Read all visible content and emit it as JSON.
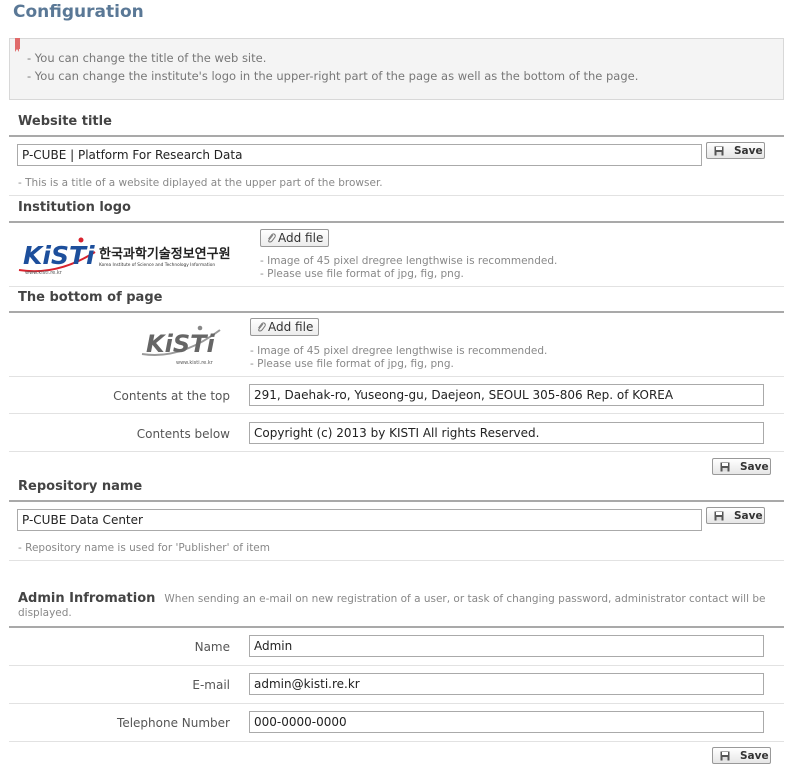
{
  "page_title": "Configuration",
  "notice": [
    "- You can change the title of the web site.",
    "- You can change the institute's logo in the upper-right part of the page as well as the bottom of the page."
  ],
  "save_label": "Save",
  "add_file_label": "Add file",
  "website_title": {
    "heading": "Website title",
    "value": "P-CUBE | Platform For Research Data",
    "hint": "- This is a title of a website diplayed at the upper part of the browser."
  },
  "institution_logo": {
    "heading": "Institution logo",
    "logo_text": "KiSTi",
    "logo_korean": "한국과학기술정보연구원",
    "logo_english": "Korea Institute of Science and Technology Information",
    "logo_url": "www.kisti.re.kr",
    "hint1": "- Image of 45 pixel dregree lengthwise is recommended.",
    "hint2": "- Please use file format of jpg, fig, png."
  },
  "bottom": {
    "heading": "The bottom of page",
    "logo_text": "KiSTi",
    "logo_url": "www.kisti.re.kr",
    "hint1": "- Image of 45 pixel dregree lengthwise is recommended.",
    "hint2": "- Please use file format of jpg, fig, png.",
    "top_label": "Contents at the top",
    "top_value": "291, Daehak-ro, Yuseong-gu, Daejeon, SEOUL 305-806 Rep. of KOREA",
    "below_label": "Contents below",
    "below_value": "Copyright (c) 2013 by KISTI All rights Reserved."
  },
  "repository": {
    "heading": "Repository name",
    "value": "P-CUBE Data Center",
    "hint": "- Repository name is used for 'Publisher' of item"
  },
  "admin": {
    "heading": "Admin Infromation",
    "desc": "When sending an e-mail on new registration of a user, or task of changing password, administrator contact will be displayed.",
    "name_label": "Name",
    "name_value": "Admin",
    "email_label": "E-mail",
    "email_value": "admin@kisti.re.kr",
    "phone_label": "Telephone Number",
    "phone_value": "000-0000-0000"
  },
  "colors": {
    "title": "#5a7896",
    "kisti_blue": "#1d4f9c",
    "kisti_red": "#d9232e"
  }
}
